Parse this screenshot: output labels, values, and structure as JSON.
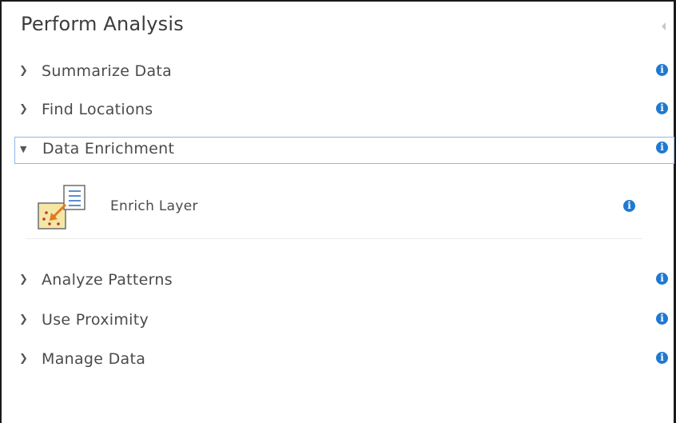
{
  "panel": {
    "title": "Perform Analysis"
  },
  "categories": [
    {
      "label": "Summarize Data",
      "expanded": false,
      "info_icon": "info-icon"
    },
    {
      "label": "Find Locations",
      "expanded": false,
      "info_icon": "info-icon"
    },
    {
      "label": "Data Enrichment",
      "expanded": true,
      "info_icon": "info-icon"
    },
    {
      "label": "Analyze Patterns",
      "expanded": false,
      "info_icon": "info-icon"
    },
    {
      "label": "Use Proximity",
      "expanded": false,
      "info_icon": "info-icon"
    },
    {
      "label": "Manage Data",
      "expanded": false,
      "info_icon": "info-icon"
    }
  ],
  "data_enrichment_tools": [
    {
      "label": "Enrich Layer",
      "icon": "enrich-layer-icon",
      "info_icon": "info-icon"
    }
  ],
  "icons": {
    "collapsed": "chevron-right-icon",
    "expanded": "chevron-down-icon",
    "panel_collapse": "collapse-left-icon",
    "info_glyph": "i"
  },
  "colors": {
    "accent": "#1f79d0",
    "expanded_border": "#8fb7e8",
    "text": "#4b4b4b"
  }
}
